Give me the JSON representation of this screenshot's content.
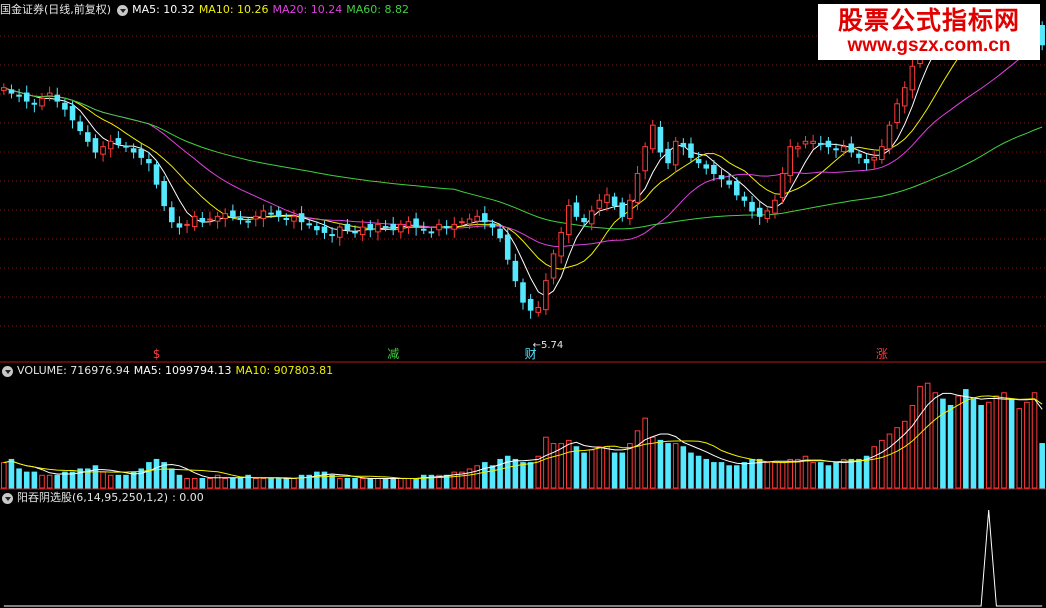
{
  "header": {
    "title": "国金证券(日线,前复权)",
    "ma5_label": "MA5: 10.32",
    "ma10_label": "MA10: 10.26",
    "ma20_label": "MA20: 10.24",
    "ma60_label": "MA60: 8.82"
  },
  "volume_header": {
    "label": "VOLUME: 716976.94",
    "ma5_label": "MA5: 1099794.13",
    "ma10_label": "MA10: 907803.81"
  },
  "indicator_header": {
    "label": "阳吞阴选股(6,14,95,250,1,2)",
    "value": ": 0.00"
  },
  "watermark": {
    "line1": "股票公式指标网",
    "line2": "www.gszx.com.cn"
  },
  "colors": {
    "up": "#ff3a3a",
    "down": "#55e8ff",
    "ma5": "#ffffff",
    "ma10": "#f0f000",
    "ma20": "#e040e0",
    "ma60": "#40d040",
    "grid": "#8a1010",
    "separator": "#b01818"
  },
  "chart_data": [
    {
      "type": "candlestick",
      "title": "国金证券(日线,前复权)",
      "y_range": [
        5.2,
        11.3
      ],
      "closes": [
        10.0,
        9.9,
        9.85,
        9.75,
        9.7,
        9.8,
        9.9,
        9.75,
        9.6,
        9.4,
        9.2,
        9.0,
        8.8,
        8.9,
        9.0,
        8.95,
        8.9,
        8.8,
        8.7,
        8.6,
        8.2,
        7.8,
        7.5,
        7.4,
        7.45,
        7.6,
        7.5,
        7.55,
        7.6,
        7.65,
        7.6,
        7.55,
        7.5,
        7.6,
        7.7,
        7.65,
        7.6,
        7.55,
        7.6,
        7.5,
        7.45,
        7.35,
        7.3,
        7.25,
        7.4,
        7.35,
        7.3,
        7.4,
        7.35,
        7.45,
        7.4,
        7.35,
        7.45,
        7.5,
        7.4,
        7.35,
        7.3,
        7.45,
        7.4,
        7.45,
        7.5,
        7.55,
        7.6,
        7.5,
        7.4,
        7.2,
        6.8,
        6.4,
        6.0,
        5.85,
        5.9,
        6.4,
        6.9,
        7.3,
        7.8,
        7.6,
        7.5,
        7.7,
        7.9,
        8.0,
        7.8,
        7.6,
        7.9,
        8.4,
        8.9,
        9.3,
        8.8,
        8.6,
        9.0,
        8.9,
        8.7,
        8.6,
        8.5,
        8.4,
        8.3,
        8.2,
        8.0,
        7.9,
        7.7,
        7.6,
        7.7,
        7.9,
        8.4,
        8.9,
        8.9,
        9.0,
        9.0,
        8.95,
        8.9,
        8.85,
        8.9,
        8.8,
        8.7,
        8.6,
        8.7,
        8.9,
        9.3,
        9.7,
        10.0,
        10.4,
        10.9,
        11.0,
        11.1,
        11.05,
        11.0,
        11.1,
        11.0,
        10.9,
        10.8,
        10.9,
        11.0,
        11.05,
        10.95,
        11.0,
        11.05,
        11.2,
        10.8
      ],
      "moving_averages": [
        "MA5: 10.32",
        "MA10: 10.26",
        "MA20: 10.24",
        "MA60: 8.82"
      ],
      "low_annotation": "5.74",
      "signal_markers": [
        {
          "label": "$",
          "index": 20,
          "color": "#ff3a3a"
        },
        {
          "label": "减",
          "index": 51,
          "color": "#40d040"
        },
        {
          "label": "财",
          "index": 69,
          "color": "#55e8ff"
        },
        {
          "label": "涨",
          "index": 115,
          "color": "#ff3a3a"
        }
      ]
    },
    {
      "type": "bar",
      "title": "VOLUME",
      "values": [
        0.8,
        0.9,
        0.6,
        0.5,
        0.5,
        0.4,
        0.4,
        0.4,
        0.5,
        0.5,
        0.6,
        0.6,
        0.7,
        0.5,
        0.4,
        0.4,
        0.4,
        0.5,
        0.6,
        0.8,
        0.9,
        0.8,
        0.6,
        0.4,
        0.3,
        0.3,
        0.3,
        0.3,
        0.4,
        0.3,
        0.3,
        0.3,
        0.4,
        0.3,
        0.3,
        0.3,
        0.3,
        0.3,
        0.3,
        0.4,
        0.4,
        0.5,
        0.5,
        0.4,
        0.3,
        0.3,
        0.3,
        0.3,
        0.3,
        0.3,
        0.3,
        0.3,
        0.3,
        0.3,
        0.3,
        0.4,
        0.4,
        0.4,
        0.4,
        0.5,
        0.5,
        0.6,
        0.7,
        0.8,
        0.7,
        0.9,
        1.0,
        0.9,
        0.8,
        0.8,
        1.0,
        1.6,
        1.4,
        1.4,
        1.5,
        1.3,
        1.1,
        1.2,
        1.3,
        1.3,
        1.1,
        1.1,
        1.4,
        1.8,
        2.2,
        1.6,
        1.5,
        1.4,
        1.4,
        1.3,
        1.1,
        1.0,
        0.9,
        0.8,
        0.8,
        0.7,
        0.7,
        0.8,
        0.9,
        0.9,
        0.8,
        0.8,
        0.8,
        0.9,
        0.9,
        1.0,
        0.8,
        0.8,
        0.7,
        0.8,
        0.9,
        0.9,
        0.9,
        1.0,
        1.3,
        1.5,
        1.7,
        1.9,
        2.1,
        2.6,
        3.2,
        3.3,
        3.0,
        2.8,
        2.6,
        2.9,
        3.1,
        2.8,
        2.6,
        2.7,
        2.9,
        3.0,
        2.8,
        2.5,
        2.7,
        3.0,
        1.4
      ],
      "ma_labels": [
        "MA5: 1099794.13",
        "MA10: 907803.81"
      ]
    },
    {
      "type": "line",
      "title": "阳吞阴选股(6,14,95,250,1,2)",
      "value_label": "0.00",
      "signal_index": 129
    }
  ]
}
